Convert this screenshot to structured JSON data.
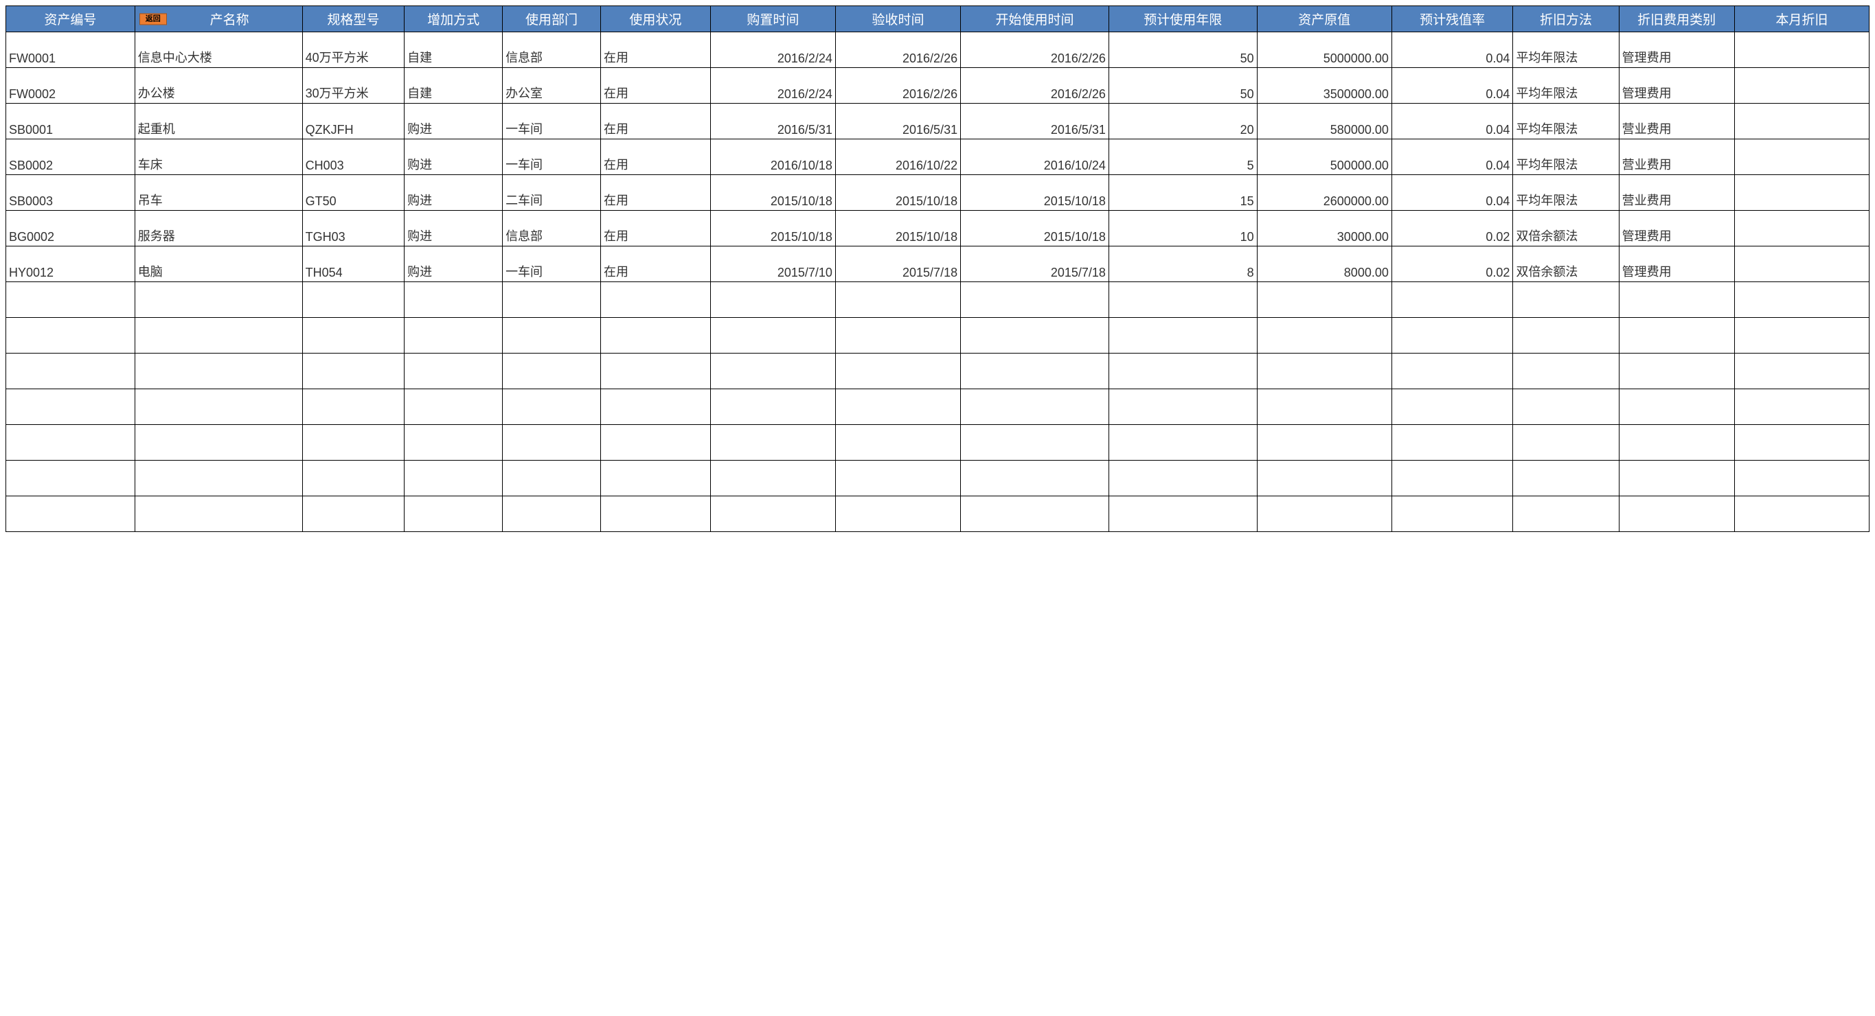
{
  "button": {
    "return_label": "返回"
  },
  "headers": {
    "asset_id": "资产编号",
    "asset_name": "资产名称",
    "asset_name_partial": "产名称",
    "spec": "规格型号",
    "add_method": "增加方式",
    "dept": "使用部门",
    "status": "使用状况",
    "purchase": "购置时间",
    "accept": "验收时间",
    "start": "开始使用时间",
    "life": "预计使用年限",
    "orig_val": "资产原值",
    "residual": "预计残值率",
    "dep_method": "折旧方法",
    "exp_cat": "折旧费用类别",
    "month_dep": "本月折旧"
  },
  "rows": [
    {
      "asset_id": "FW0001",
      "asset_name": "信息中心大楼",
      "spec": "40万平方米",
      "add_method": "自建",
      "dept": "信息部",
      "status": "在用",
      "purchase": "2016/2/24",
      "accept": "2016/2/26",
      "start": "2016/2/26",
      "life": "50",
      "orig_val": "5000000.00",
      "residual": "0.04",
      "dep_method": "平均年限法",
      "exp_cat": "管理费用",
      "month_dep": ""
    },
    {
      "asset_id": "FW0002",
      "asset_name": "办公楼",
      "spec": "30万平方米",
      "add_method": "自建",
      "dept": "办公室",
      "status": "在用",
      "purchase": "2016/2/24",
      "accept": "2016/2/26",
      "start": "2016/2/26",
      "life": "50",
      "orig_val": "3500000.00",
      "residual": "0.04",
      "dep_method": "平均年限法",
      "exp_cat": "管理费用",
      "month_dep": ""
    },
    {
      "asset_id": "SB0001",
      "asset_name": "起重机",
      "spec": "QZKJFH",
      "add_method": "购进",
      "dept": "一车间",
      "status": "在用",
      "purchase": "2016/5/31",
      "accept": "2016/5/31",
      "start": "2016/5/31",
      "life": "20",
      "orig_val": "580000.00",
      "residual": "0.04",
      "dep_method": "平均年限法",
      "exp_cat": "营业费用",
      "month_dep": ""
    },
    {
      "asset_id": "SB0002",
      "asset_name": "车床",
      "spec": "CH003",
      "add_method": "购进",
      "dept": "一车间",
      "status": "在用",
      "purchase": "2016/10/18",
      "accept": "2016/10/22",
      "start": "2016/10/24",
      "life": "5",
      "orig_val": "500000.00",
      "residual": "0.04",
      "dep_method": "平均年限法",
      "exp_cat": "营业费用",
      "month_dep": ""
    },
    {
      "asset_id": "SB0003",
      "asset_name": "吊车",
      "spec": "GT50",
      "add_method": "购进",
      "dept": "二车间",
      "status": "在用",
      "purchase": "2015/10/18",
      "accept": "2015/10/18",
      "start": "2015/10/18",
      "life": "15",
      "orig_val": "2600000.00",
      "residual": "0.04",
      "dep_method": "平均年限法",
      "exp_cat": "营业费用",
      "month_dep": ""
    },
    {
      "asset_id": "BG0002",
      "asset_name": "服务器",
      "spec": "TGH03",
      "add_method": "购进",
      "dept": "信息部",
      "status": "在用",
      "purchase": "2015/10/18",
      "accept": "2015/10/18",
      "start": "2015/10/18",
      "life": "10",
      "orig_val": "30000.00",
      "residual": "0.02",
      "dep_method": "双倍余额法",
      "exp_cat": "管理费用",
      "month_dep": ""
    },
    {
      "asset_id": "HY0012",
      "asset_name": "电脑",
      "spec": "TH054",
      "add_method": "购进",
      "dept": "一车间",
      "status": "在用",
      "purchase": "2015/7/10",
      "accept": "2015/7/18",
      "start": "2015/7/18",
      "life": "8",
      "orig_val": "8000.00",
      "residual": "0.02",
      "dep_method": "双倍余额法",
      "exp_cat": "管理费用",
      "month_dep": ""
    }
  ],
  "empty_row_count": 7
}
